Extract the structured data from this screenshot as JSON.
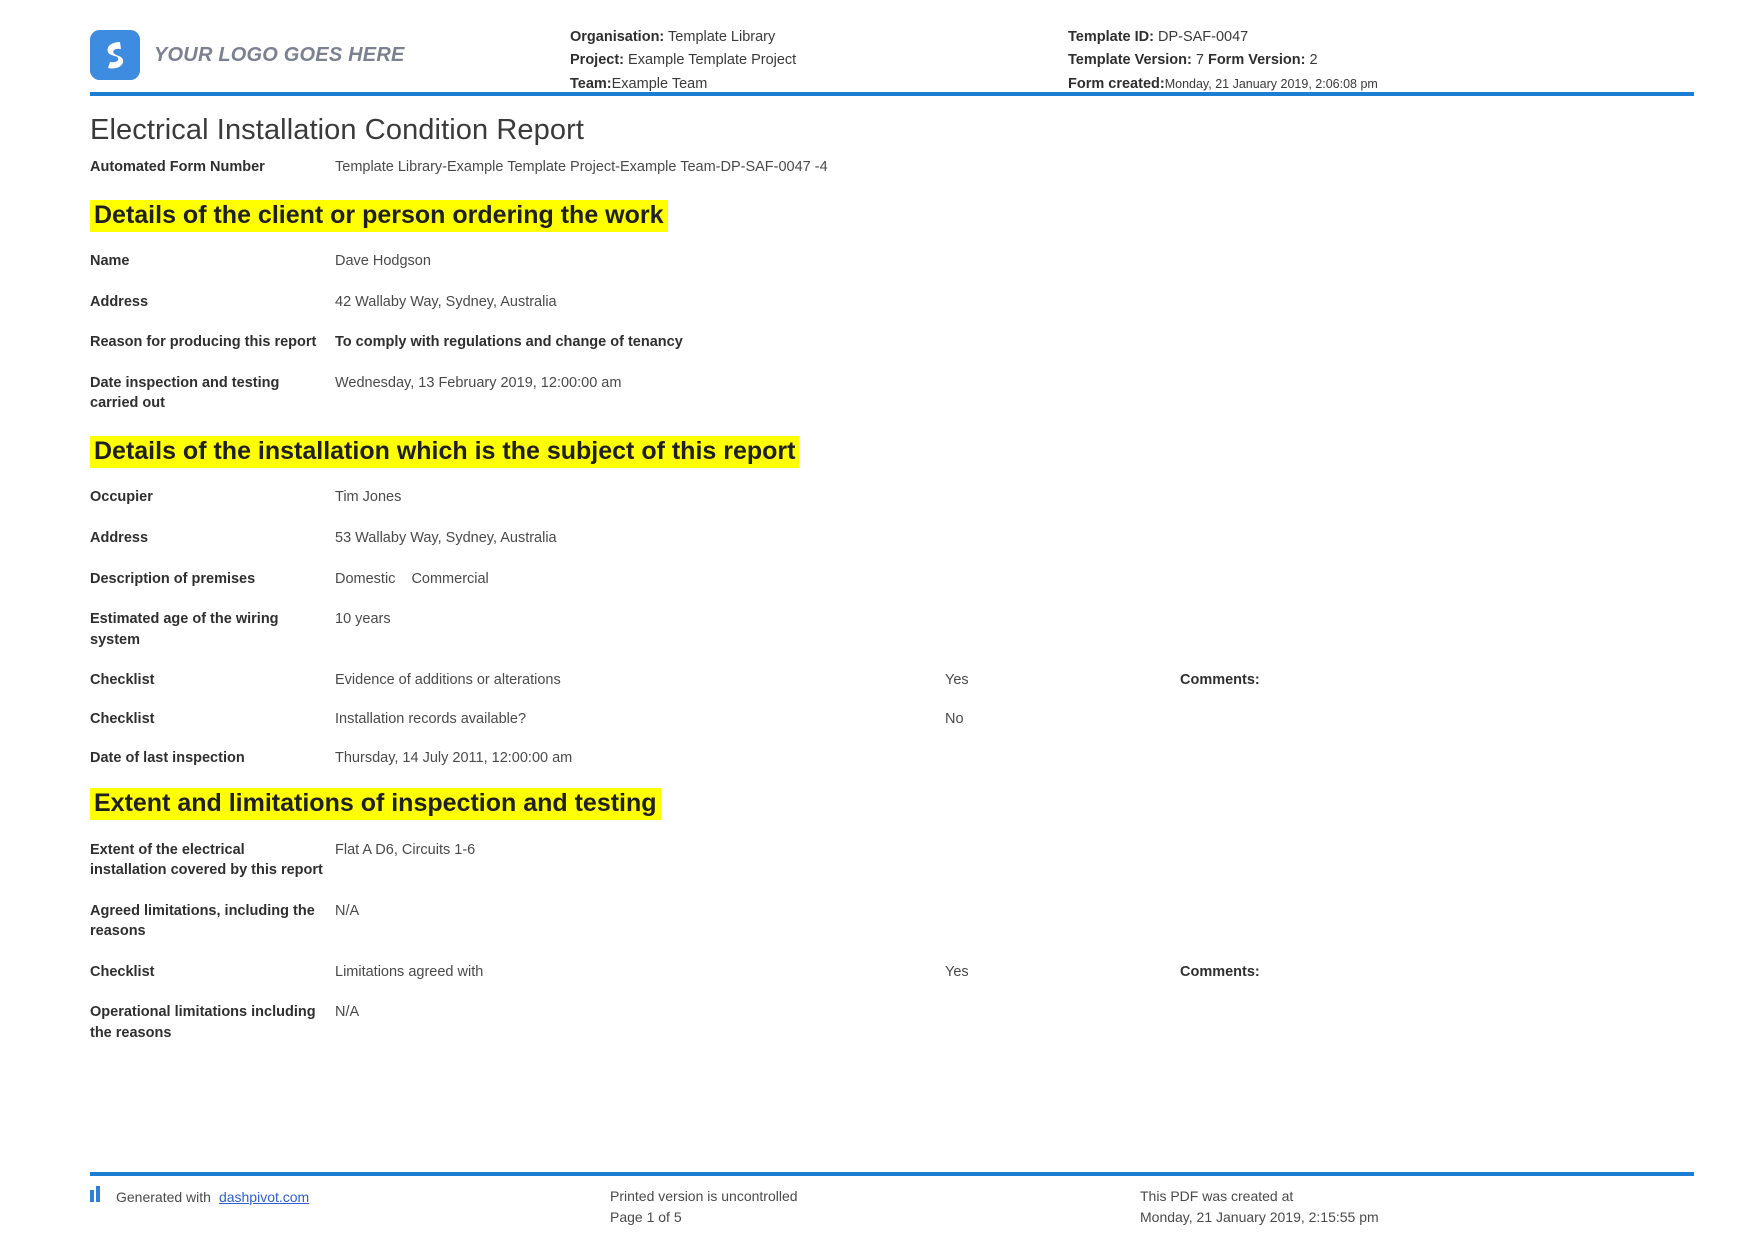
{
  "brand": {
    "accent_blue": "#1a7fd4",
    "logo_blue": "#3d8ce0",
    "highlight_yellow": "#ffff00",
    "logo_text": "YOUR LOGO GOES HERE"
  },
  "header": {
    "mid": [
      {
        "key": "Organisation:",
        "value": "Template Library"
      },
      {
        "key": "Project:",
        "value": "Example Template Project"
      },
      {
        "key": "Team:",
        "value": "Example Team"
      }
    ],
    "right": [
      {
        "key": "Template ID:",
        "value": "DP-SAF-0047"
      },
      {
        "key": "Template Version:",
        "value": "7",
        "key2": "Form Version:",
        "value2": "2"
      },
      {
        "key": "Form created:",
        "value": "Monday, 21 January 2019, 2:06:08 pm"
      }
    ]
  },
  "document": {
    "title": "Electrical Installation Condition Report",
    "automated_form_number_label": "Automated Form Number",
    "automated_form_number_value": "Template Library-Example Template Project-Example Team-DP-SAF-0047   -4"
  },
  "sections": [
    {
      "heading": "Details of the client or person ordering the work",
      "rows": [
        {
          "label": "Name",
          "value": "Dave Hodgson",
          "bold": false
        },
        {
          "label": "Address",
          "value": "42 Wallaby Way, Sydney, Australia",
          "bold": false
        },
        {
          "label": "Reason for producing this report",
          "value": "To comply with regulations and change of tenancy",
          "bold": true
        },
        {
          "label": "Date inspection and testing carried out",
          "value": "Wednesday, 13 February 2019, 12:00:00 am",
          "bold": false
        }
      ]
    },
    {
      "heading": "Details of the installation which is the subject of this report",
      "rows": [
        {
          "label": "Occupier",
          "value": "Tim Jones",
          "bold": false
        },
        {
          "label": "Address",
          "value": "53 Wallaby Way, Sydney, Australia",
          "bold": false
        },
        {
          "label": "Description of premises",
          "value": "Domestic   Commercial",
          "option_a": "Domestic",
          "option_b": "Commercial",
          "bold": false
        },
        {
          "label": "Estimated age of the wiring system",
          "value": "10 years",
          "bold": false
        },
        {
          "label": "Checklist",
          "value": "Evidence of additions or alterations",
          "answer": "Yes",
          "comments": "Comments:",
          "bold": false
        },
        {
          "label": "Checklist",
          "value": "Installation records available?",
          "answer": "No",
          "comments": "",
          "bold": false
        },
        {
          "label": "Date of last inspection",
          "value": "Thursday, 14 July 2011, 12:00:00 am",
          "bold": false
        }
      ]
    },
    {
      "heading": "Extent and limitations of inspection and testing",
      "rows": [
        {
          "label": "Extent of the electrical installation covered by this report",
          "value": "Flat A D6, Circuits 1-6",
          "bold": false
        },
        {
          "label": "Agreed limitations, including the reasons",
          "value": "N/A",
          "bold": false
        },
        {
          "label": "Checklist",
          "value": "Limitations agreed with",
          "answer": "Yes",
          "comments": "Comments:",
          "bold": false
        },
        {
          "label": "Operational limitations including the reasons",
          "value": "N/A",
          "bold": false
        }
      ]
    }
  ],
  "footer": {
    "generated_prefix": "Generated with",
    "generated_link": "dashpivot.com",
    "printed_notice": "Printed version is uncontrolled",
    "page_number": "Page 1 of 5",
    "created_notice": "This PDF was created at",
    "created_timestamp": "Monday, 21 January 2019, 2:15:55 pm"
  }
}
